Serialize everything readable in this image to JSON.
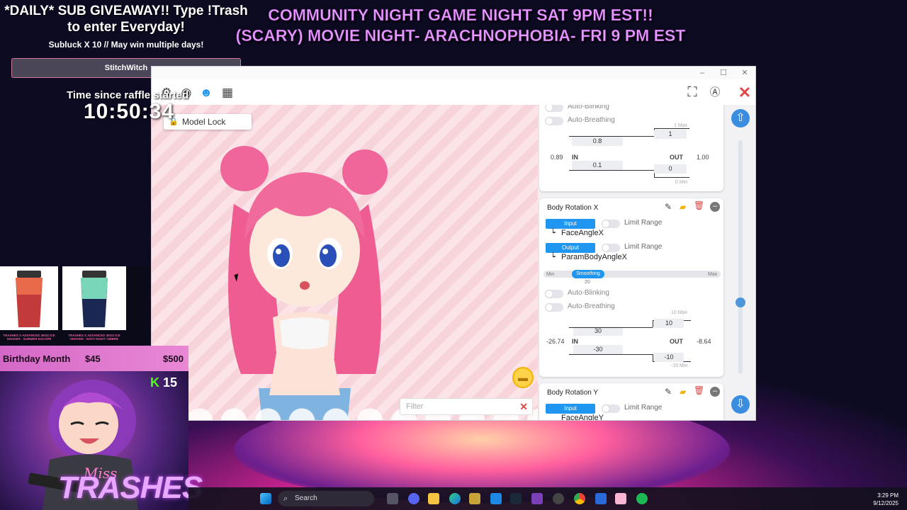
{
  "overlay": {
    "giveaway_title": "*DAILY* SUB GIVEAWAY!! Type !Trash to enter Everyday!",
    "subluck": "Subluck X 10 // May win multiple days!",
    "winner": "StitchWitch",
    "raffle_label": "Time since raffle started",
    "raffle_time": "10:50:34",
    "banner_line1": "COMMUNITY NIGHT GAME NIGHT SAT 9PM EST!!",
    "banner_line2": "(SCARY) MOVIE NIGHT- ARACHNOPHOBIA- FRI 9 PM EST"
  },
  "window": {
    "minimize": "–",
    "maximize": "☐",
    "close": "✕",
    "model_lock": "Model Lock",
    "filter_placeholder": "Filter"
  },
  "panel": {
    "top_card": {
      "auto_blinking": "Auto-Blinking",
      "auto_breathing": "Auto-Breathing",
      "max_label": "1 Max",
      "min_label": "0 Min",
      "in_value": "0.89",
      "in_label": "IN",
      "in_upper": "0.8",
      "in_lower": "0.1",
      "out_label": "OUT",
      "out_value": "1.00",
      "out_upper": "1",
      "out_lower": "0"
    },
    "rot_x": {
      "title": "Body Rotation X",
      "input_pill": "Input",
      "output_pill": "Output",
      "limit_range": "Limit Range",
      "input_param": "FaceAngleX",
      "output_param": "ParamBodyAngleX",
      "smooth_min": "Min",
      "smooth_label": "Smoothing",
      "smooth_max": "Max",
      "smooth_value": "20",
      "auto_blinking": "Auto-Blinking",
      "auto_breathing": "Auto-Breathing",
      "max_label": "10 Max",
      "min_label": "-10 Min",
      "in_value": "-26.74",
      "in_label": "IN",
      "in_upper": "30",
      "in_lower": "-30",
      "out_label": "OUT",
      "out_value": "-8.64",
      "out_upper": "10",
      "out_lower": "-10"
    },
    "rot_y": {
      "title": "Body Rotation Y",
      "input_pill": "Input",
      "limit_range": "Limit Range",
      "input_param": "FaceAngleY"
    }
  },
  "merch": {
    "item1": "TRASHES X ADVANCED 36OZ ICE SHAKER - SUMMER ESCAPE",
    "item2": "TRASHES X ADVANCED 36OZ ICE SHAKER - NAVY NIGHT OMBRE"
  },
  "birthday": {
    "label": "Birthday Month",
    "current": "$45",
    "goal": "$500"
  },
  "cam": {
    "badge_k": "K",
    "badge_count": "15",
    "brand_small": "Miss",
    "brand": "TRASHES"
  },
  "taskbar": {
    "search": "Search",
    "time": "3:29 PM",
    "date": "9/12/2025"
  },
  "colors": {
    "accent_blue": "#1f96ef",
    "banner_purple": "#e59cff",
    "close_red": "#e04848"
  }
}
